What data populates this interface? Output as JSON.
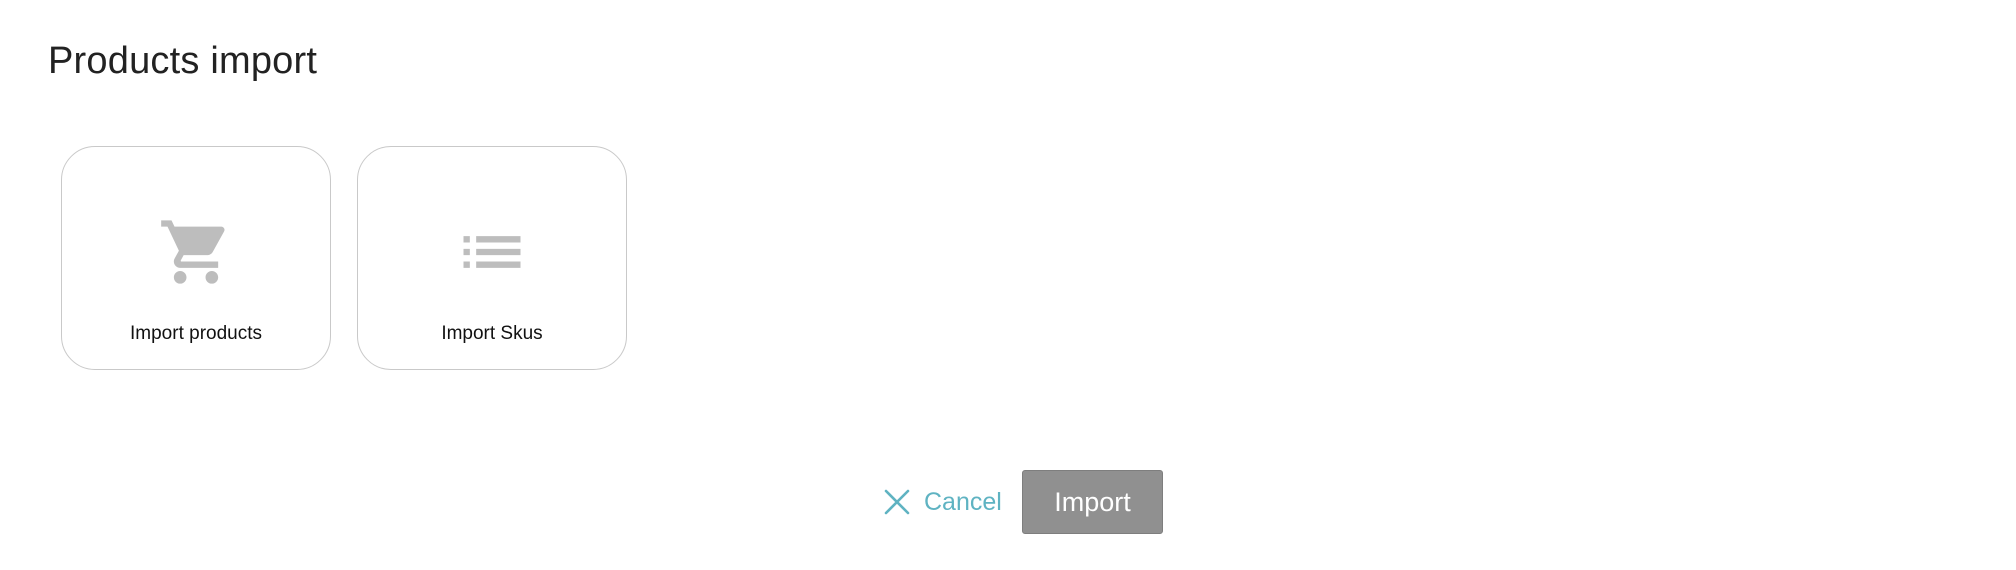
{
  "dialog": {
    "title": "Products import"
  },
  "options": [
    {
      "label": "Import products",
      "icon": "shopping-cart-icon"
    },
    {
      "label": "Import Skus",
      "icon": "list-icon"
    }
  ],
  "footer": {
    "cancel_label": "Cancel",
    "cancel_icon": "close-icon",
    "import_label": "Import"
  },
  "colors": {
    "accent": "#5fb3c2",
    "icon_gray": "#bdbdbd",
    "import_button": "#909090",
    "card_border": "#c9c9c9"
  }
}
